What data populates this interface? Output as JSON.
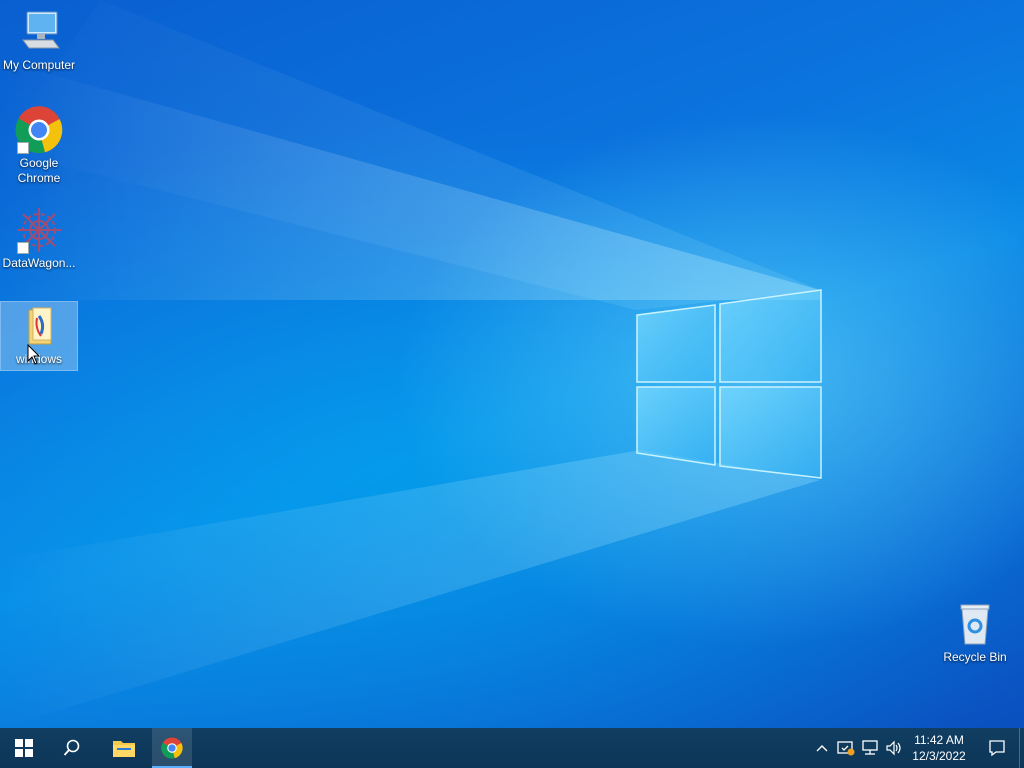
{
  "desktop": {
    "icons": [
      {
        "label": "My Computer",
        "icon": "computer-icon"
      },
      {
        "label": "Google Chrome",
        "icon": "chrome-icon",
        "shortcut": true
      },
      {
        "label": "DataWagon...",
        "icon": "datawagon-icon",
        "shortcut": true
      },
      {
        "label": "windows",
        "icon": "folder-icon",
        "selected": true
      },
      {
        "label": "Recycle Bin",
        "icon": "recycle-bin-icon"
      }
    ]
  },
  "taskbar": {
    "start": {
      "icon": "windows-logo-icon"
    },
    "search": {
      "icon": "search-icon"
    },
    "pinned": [
      {
        "name": "File Explorer",
        "icon": "file-explorer-icon"
      },
      {
        "name": "Google Chrome",
        "icon": "chrome-icon",
        "active": true
      }
    ],
    "tray": {
      "icons": [
        "chevron-up-icon",
        "security-icon",
        "network-icon",
        "volume-icon"
      ]
    },
    "clock": {
      "time": "11:42 AM",
      "date": "12/3/2022"
    },
    "notification": {
      "icon": "notification-icon"
    }
  },
  "colors": {
    "taskbar": "#0d3556",
    "accent": "#5ab0ff",
    "desktop": "#0a78de"
  }
}
